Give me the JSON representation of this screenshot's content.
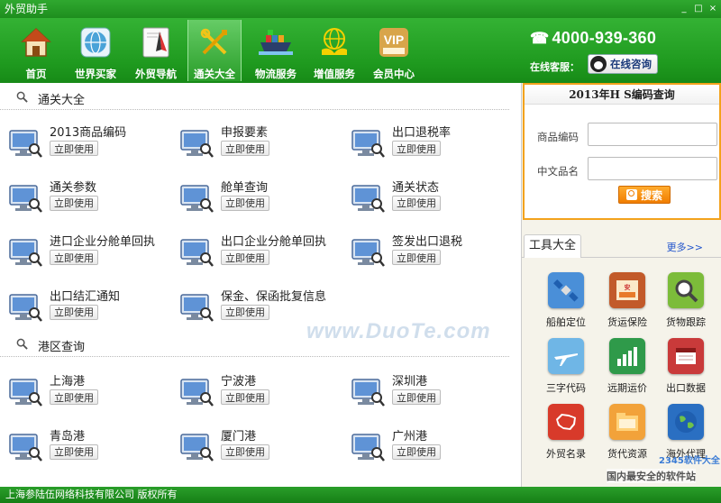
{
  "window": {
    "title": "外贸助手",
    "controls": [
      "_",
      "□",
      "×"
    ]
  },
  "nav": {
    "items": [
      {
        "label": "首页",
        "icon": "house-icon",
        "color": "#c8872b"
      },
      {
        "label": "世界买家",
        "icon": "globe-icon",
        "color": "#4aa3d8"
      },
      {
        "label": "外贸导航",
        "icon": "compass-icon",
        "color": "#e6e6e6"
      },
      {
        "label": "通关大全",
        "icon": "tools-icon",
        "color": "#f0c419"
      },
      {
        "label": "物流服务",
        "icon": "ship-icon",
        "color": "#3a7fc2"
      },
      {
        "label": "增值服务",
        "icon": "globe-hands-icon",
        "color": "#f5d000"
      },
      {
        "label": "会员中心",
        "icon": "vip-icon",
        "color": "#d8a54a"
      }
    ],
    "active_index": 3,
    "phone": "4000-939-360",
    "cs_label": "在线客服：",
    "qq_button": "在线咨询"
  },
  "customs": {
    "title": "通关大全",
    "use_label": "立即使用",
    "tools": [
      "2013商品编码",
      "申报要素",
      "出口退税率",
      "通关参数",
      "舱单查询",
      "通关状态",
      "进口企业分舱单回执",
      "出口企业分舱单回执",
      "签发出口退税",
      "出口结汇通知",
      "保金、保函批复信息"
    ]
  },
  "ports": {
    "title": "港区查询",
    "tools": [
      "上海港",
      "宁波港",
      "深圳港",
      "青岛港",
      "厦门港",
      "广州港"
    ]
  },
  "hs_query": {
    "title": "2013年H S编码查询",
    "code_label": "商品编码",
    "code_value": "",
    "name_label": "中文品名",
    "name_value": "",
    "search_label": "搜索"
  },
  "toolbox": {
    "title": "工具大全",
    "more": "更多>>",
    "items": [
      {
        "label": "船舶定位",
        "icon": "satellite-icon",
        "color": "#4a8fd8"
      },
      {
        "label": "货运保险",
        "icon": "insurance-icon",
        "color": "#c25a2a"
      },
      {
        "label": "货物跟踪",
        "icon": "magnifier-icon",
        "color": "#7cbc3a"
      },
      {
        "label": "三字代码",
        "icon": "airplane-icon",
        "color": "#6fb6e6"
      },
      {
        "label": "远期运价",
        "icon": "chart-icon",
        "color": "#2f9a4a"
      },
      {
        "label": "出口数据",
        "icon": "book-icon",
        "color": "#c93a3a"
      },
      {
        "label": "外贸名录",
        "icon": "china-map-icon",
        "color": "#d83a2a"
      },
      {
        "label": "货代资源",
        "icon": "folder-icon",
        "color": "#f2a23a"
      },
      {
        "label": "海外代理",
        "icon": "earth-icon",
        "color": "#2a6fc2"
      }
    ]
  },
  "status": {
    "text": "上海参陆伍网络科技有限公司 版权所有"
  },
  "watermark": {
    "text": "www.DuoTe.com",
    "corner_top": "2345软件大全",
    "corner_bottom": "国内最安全的软件站"
  }
}
